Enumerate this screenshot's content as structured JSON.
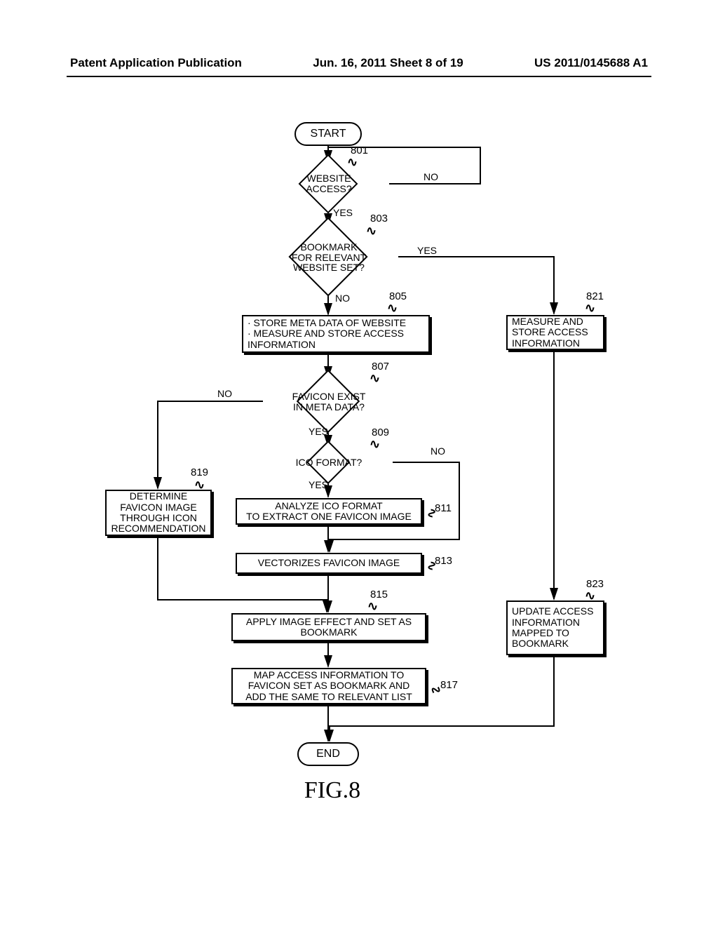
{
  "header": {
    "left": "Patent Application Publication",
    "center": "Jun. 16, 2011  Sheet 8 of 19",
    "right": "US 2011/0145688 A1"
  },
  "chart_data": {
    "type": "flowchart",
    "figure_label": "FIG.8",
    "nodes": [
      {
        "id": "start",
        "type": "terminal",
        "text": "START"
      },
      {
        "id": "801",
        "type": "decision",
        "ref": "801",
        "text": "WEBSITE\nACCESS?"
      },
      {
        "id": "803",
        "type": "decision",
        "ref": "803",
        "text": "BOOKMARK\nFOR RELEVANT\nWEBSITE SET?"
      },
      {
        "id": "805",
        "type": "process",
        "ref": "805",
        "text": "· STORE META DATA OF WEBSITE\n· MEASURE AND STORE ACCESS\n  INFORMATION"
      },
      {
        "id": "821",
        "type": "process",
        "ref": "821",
        "text": "MEASURE AND\nSTORE ACCESS\nINFORMATION"
      },
      {
        "id": "807",
        "type": "decision",
        "ref": "807",
        "text": "FAVICON EXIST\nIN META DATA?"
      },
      {
        "id": "809",
        "type": "decision",
        "ref": "809",
        "text": "ICO FORMAT?"
      },
      {
        "id": "811",
        "type": "process",
        "ref": "811",
        "text": "ANALYZE ICO FORMAT\nTO EXTRACT ONE FAVICON IMAGE"
      },
      {
        "id": "819",
        "type": "process",
        "ref": "819",
        "text": "DETERMINE\nFAVICON IMAGE\nTHROUGH ICON\nRECOMMENDATION"
      },
      {
        "id": "813",
        "type": "process",
        "ref": "813",
        "text": "VECTORIZES FAVICON IMAGE"
      },
      {
        "id": "815",
        "type": "process",
        "ref": "815",
        "text": "APPLY IMAGE EFFECT AND SET AS\nBOOKMARK"
      },
      {
        "id": "823",
        "type": "process",
        "ref": "823",
        "text": "UPDATE ACCESS\nINFORMATION\nMAPPED TO\nBOOKMARK"
      },
      {
        "id": "817",
        "type": "process",
        "ref": "817",
        "text": "MAP ACCESS INFORMATION TO\nFAVICON SET AS BOOKMARK AND\nADD THE SAME TO RELEVANT LIST"
      },
      {
        "id": "end",
        "type": "terminal",
        "text": "END"
      }
    ],
    "edges": [
      {
        "from": "start",
        "to": "801"
      },
      {
        "from": "801",
        "to": "803",
        "label": "YES"
      },
      {
        "from": "801",
        "to": "801",
        "label": "NO",
        "note": "loop-back"
      },
      {
        "from": "803",
        "to": "805",
        "label": "NO"
      },
      {
        "from": "803",
        "to": "821",
        "label": "YES"
      },
      {
        "from": "805",
        "to": "807"
      },
      {
        "from": "807",
        "to": "809",
        "label": "YES"
      },
      {
        "from": "807",
        "to": "819",
        "label": "NO"
      },
      {
        "from": "809",
        "to": "811",
        "label": "YES"
      },
      {
        "from": "809",
        "to": "813",
        "label": "NO",
        "note": "bypass 811"
      },
      {
        "from": "811",
        "to": "813"
      },
      {
        "from": "819",
        "to": "815"
      },
      {
        "from": "813",
        "to": "815"
      },
      {
        "from": "815",
        "to": "817"
      },
      {
        "from": "821",
        "to": "823"
      },
      {
        "from": "823",
        "to": "end"
      },
      {
        "from": "817",
        "to": "end"
      }
    ],
    "edge_labels": {
      "yes": "YES",
      "no": "NO"
    }
  }
}
